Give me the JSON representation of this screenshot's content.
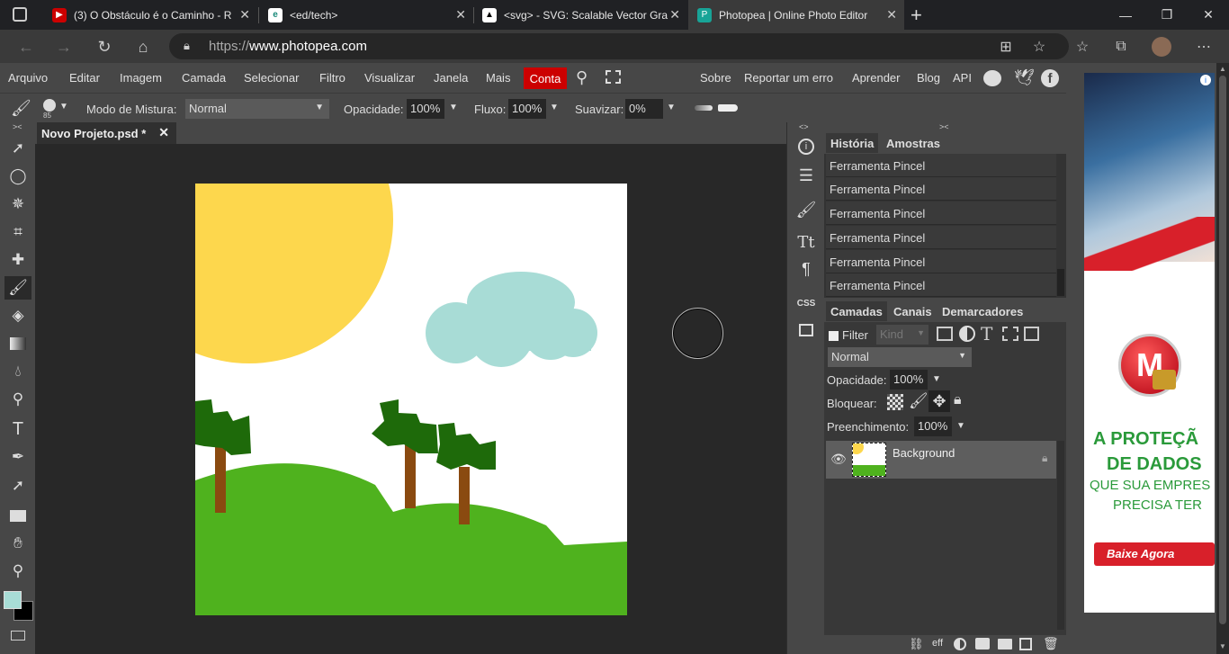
{
  "browser": {
    "tabs": [
      {
        "title": "(3) O Obstáculo é o Caminho - R",
        "icon": "youtube-icon",
        "color": "#cc0000"
      },
      {
        "title": "<ed/tech>",
        "icon": "edtech-icon",
        "color": "#ffffff"
      },
      {
        "title": "<svg> - SVG: Scalable Vector Gra",
        "icon": "mdn-icon",
        "color": "#000000"
      },
      {
        "title": "Photopea | Online Photo Editor",
        "icon": "photopea-icon",
        "color": "#18a497"
      }
    ],
    "url_prefix": "https://",
    "url_domain": "www.photopea.com"
  },
  "menu": {
    "items": [
      "Arquivo",
      "Editar",
      "Imagem",
      "Camada",
      "Selecionar",
      "Filtro",
      "Visualizar",
      "Janela",
      "Mais"
    ],
    "account": "Conta",
    "right_items": [
      "Sobre",
      "Reportar um erro",
      "Aprender",
      "Blog",
      "API"
    ]
  },
  "options": {
    "brush_size": "85",
    "blend_label": "Modo de Mistura:",
    "blend_value": "Normal",
    "opacity_label": "Opacidade:",
    "opacity_value": "100%",
    "flow_label": "Fluxo:",
    "flow_value": "100%",
    "smooth_label": "Suavizar:",
    "smooth_value": "0%"
  },
  "document": {
    "tab_title": "Novo Projeto.psd *"
  },
  "colors": {
    "foreground": "#a8ddd6",
    "background": "#000000",
    "accent_red": "#cc0000"
  },
  "history": {
    "tabs": [
      "História",
      "Amostras"
    ],
    "items": [
      "Ferramenta Pincel",
      "Ferramenta Pincel",
      "Ferramenta Pincel",
      "Ferramenta Pincel",
      "Ferramenta Pincel",
      "Ferramenta Pincel"
    ]
  },
  "layers": {
    "tabs": [
      "Camadas",
      "Canais",
      "Demarcadores"
    ],
    "filter_label": "Filter",
    "kind_placeholder": "Kind",
    "blend_value": "Normal",
    "opacity_label": "Opacidade:",
    "opacity_value": "100%",
    "lock_label": "Bloquear:",
    "fill_label": "Preenchimento:",
    "fill_value": "100%",
    "layer_name": "Background",
    "footer_eff": "eff"
  },
  "strip": {
    "css_label": "CSS"
  },
  "ad": {
    "line1": "A PROTEÇÃ",
    "line2": "DE DADOS",
    "line3": "QUE SUA EMPRES",
    "line4": "PRECISA TER",
    "button": "Baixe Agora",
    "logo_letter": "M"
  }
}
